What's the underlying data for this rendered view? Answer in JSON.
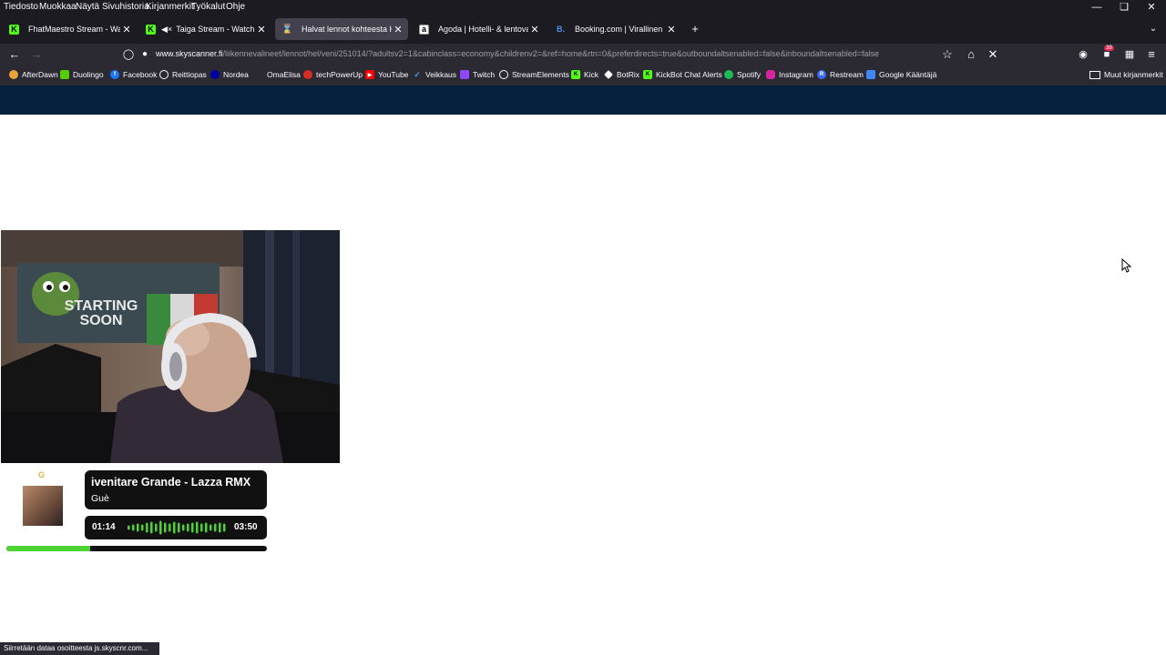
{
  "menubar": {
    "items": [
      "Tiedosto",
      "Muokkaa",
      "Näytä",
      "Sivuhistoria",
      "Kirjanmerkit",
      "Työkalut",
      "Ohje"
    ]
  },
  "tabs": [
    {
      "label": "FhatMaestro Stream - Watch",
      "favicon": "kick-icon",
      "active": false,
      "audio": false
    },
    {
      "label": "Taiga Stream - Watch Live o",
      "favicon": "kick-icon",
      "active": false,
      "audio": true
    },
    {
      "label": "Halvat lennot kohteesta Helsinki",
      "favicon": "loading-hourglass-icon",
      "active": true,
      "audio": false
    },
    {
      "label": "Agoda | Hotelli- & lentovarauks",
      "favicon": "agoda-icon",
      "active": false,
      "audio": false
    },
    {
      "label": "Booking.com | Virallinen sivusto",
      "favicon": "booking-icon",
      "active": false,
      "audio": false
    }
  ],
  "navbar": {
    "url_host": "www.skyscanner.fi",
    "url_path": "/liikennevalineet/lennot/hel/veni/251014/?adultsv2=1&cabinclass=economy&childrenv2=&ref=home&rtn=0&preferdirects=true&outboundaltsenabled=false&inboundaltsenabled=false",
    "extension_badge": "39"
  },
  "bookmarks": {
    "items": [
      {
        "label": "AfterDawn",
        "icon": "afterdawn-icon",
        "color": "#e8a33b"
      },
      {
        "label": "Duolingo",
        "icon": "duolingo-icon",
        "color": "#58cc02"
      },
      {
        "label": "Facebook",
        "icon": "facebook-icon",
        "color": "#1877f2"
      },
      {
        "label": "Reittiopas",
        "icon": "globe-icon",
        "color": "#555560"
      },
      {
        "label": "Nordea",
        "icon": "nordea-icon",
        "color": "#0000a0"
      },
      {
        "label": "OmaElisa",
        "icon": "elisa-icon",
        "color": "#2b2a33"
      },
      {
        "label": "techPowerUp",
        "icon": "techpowerup-icon",
        "color": "#d62d20"
      },
      {
        "label": "YouTube",
        "icon": "youtube-icon",
        "color": "#ff0000"
      },
      {
        "label": "Veikkaus",
        "icon": "veikkaus-icon",
        "color": "#2b2a33"
      },
      {
        "label": "Twitch",
        "icon": "twitch-icon",
        "color": "#9146ff"
      },
      {
        "label": "StreamElements",
        "icon": "streamelements-icon",
        "color": "#2b2a33"
      },
      {
        "label": "Kick",
        "icon": "kick-icon",
        "color": "#53fc18"
      },
      {
        "label": "BotRix",
        "icon": "botrix-icon",
        "color": "#2b2a33"
      },
      {
        "label": "KickBot Chat Alerts",
        "icon": "kick-icon",
        "color": "#53fc18"
      },
      {
        "label": "Spotify",
        "icon": "spotify-icon",
        "color": "#1db954"
      },
      {
        "label": "Instagram",
        "icon": "instagram-icon",
        "color": "#d6249f"
      },
      {
        "label": "Restream",
        "icon": "restream-icon",
        "color": "#3b6bf5"
      },
      {
        "label": "Google Kääntäjä",
        "icon": "google-translate-icon",
        "color": "#4285f4"
      }
    ],
    "other_label": "Muut kirjanmerkit"
  },
  "webcam": {
    "poster_line1": "STARTING",
    "poster_line2": "SOON"
  },
  "now_playing": {
    "title": "ivenitare Grande - Lazza RMX",
    "artist": "Guè",
    "elapsed": "01:14",
    "duration": "03:50",
    "progress": 0.32,
    "accent": "#4cd433"
  },
  "status": {
    "text": "Siirretään dataa osoitteesta js.skyscnr.com..."
  },
  "colors": {
    "chrome_dark": "#1c1b22",
    "chrome": "#2b2a33",
    "site_header": "#05203c"
  }
}
